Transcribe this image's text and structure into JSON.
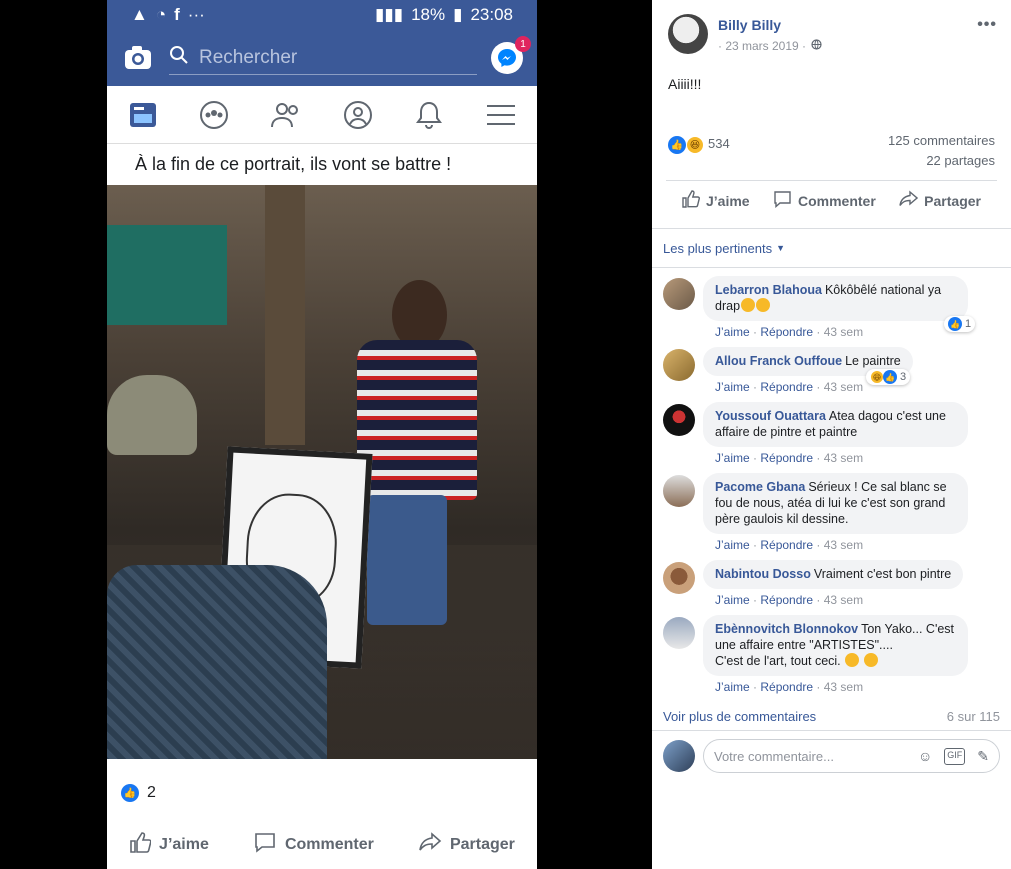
{
  "phone": {
    "status_time": "23:08",
    "status_battery": "18%",
    "search_placeholder": "Rechercher",
    "messenger_badge": "1",
    "caption": "À la fin de ce portrait, ils vont se battre !",
    "reaction_count": "2",
    "actions": {
      "like": "J’aime",
      "comment": "Commenter",
      "share": "Partager"
    }
  },
  "post": {
    "author": "Billy Billy",
    "date": "· 23 mars 2019 ·",
    "text": "Aiiii!!!",
    "reaction_count": "534",
    "comments_count": "125 commentaires",
    "shares_count": "22 partages",
    "actions": {
      "like": "J’aime",
      "comment": "Commenter",
      "share": "Partager"
    }
  },
  "sort": {
    "label": "Les plus pertinents"
  },
  "comments": [
    {
      "author": "Lebarron Blahoua",
      "text": "Kôkôbêlé national ya drap",
      "like": "J’aime",
      "reply": "Répondre",
      "time": "43 sem",
      "reactions": "1"
    },
    {
      "author": "Allou Franck Ouffoue",
      "text": "Le paintre",
      "like": "J’aime",
      "reply": "Répondre",
      "time": "43 sem",
      "reactions": "3"
    },
    {
      "author": "Youssouf Ouattara",
      "text": "Atea dagou c'est une affaire de pintre et paintre",
      "like": "J’aime",
      "reply": "Répondre",
      "time": "43 sem"
    },
    {
      "author": "Pacome Gbana",
      "text": "Sérieux ! Ce sal blanc se fou de nous, atéa di lui ke c'est son grand père gaulois kil dessine.",
      "like": "J’aime",
      "reply": "Répondre",
      "time": "43 sem"
    },
    {
      "author": "Nabintou Dosso",
      "text": "Vraiment c'est bon pintre",
      "like": "J’aime",
      "reply": "Répondre",
      "time": "43 sem"
    },
    {
      "author": "Ebènnovitch Blonnokov",
      "text": "Ton Yako... C'est une affaire entre \"ARTISTES\"....",
      "text2": "C'est de l'art, tout ceci.",
      "like": "J’aime",
      "reply": "Répondre",
      "time": "43 sem"
    }
  ],
  "more_comments": {
    "label": "Voir plus de commentaires",
    "count": "6 sur 115"
  },
  "composer": {
    "placeholder": "Votre commentaire..."
  },
  "colors": {
    "fb_blue": "#3b5998",
    "link": "#385898",
    "like_blue": "#1877f2"
  }
}
